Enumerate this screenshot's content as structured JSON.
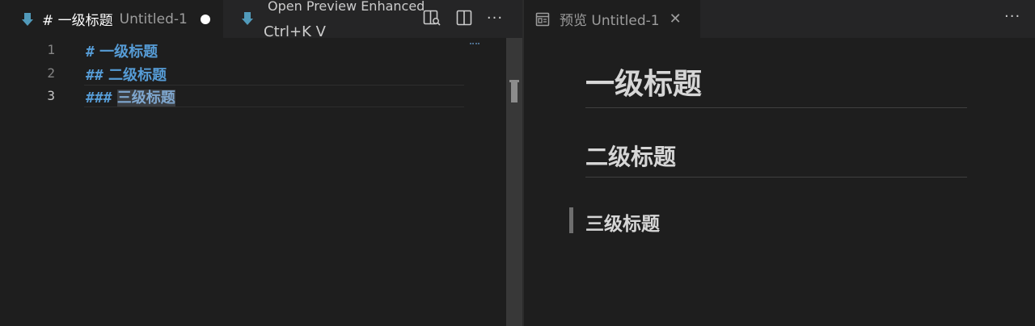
{
  "colors": {
    "editor_bg": "#1e1e1e",
    "tabbar_bg": "#252526",
    "markdown_icon": "#519aba",
    "heading_syntax": "#569cd6",
    "preview_text": "#d6d6d6"
  },
  "left_group": {
    "active_tab": {
      "icon": "markdown-arrow-icon",
      "title": "# 一级标题",
      "description": "Untitled-1",
      "dirty": true
    },
    "tooltip": {
      "icon": "markdown-arrow-icon",
      "title": "Open Preview Enhanced",
      "keybinding": "Ctrl+K V"
    },
    "actions": [
      "open-preview-icon",
      "split-editor-icon",
      "more-actions-icon"
    ],
    "more_label": "···"
  },
  "editor": {
    "lines": [
      {
        "number": "1",
        "hash": "#",
        "text": "一级标题"
      },
      {
        "number": "2",
        "hash": "##",
        "text": "二级标题"
      },
      {
        "number": "3",
        "hash": "###",
        "text": "三级标题"
      }
    ],
    "active_line": 3
  },
  "right_group": {
    "tab": {
      "icon": "preview-icon",
      "title": "预览 Untitled-1",
      "close": "✕"
    },
    "more_label": "···"
  },
  "preview": {
    "h1": "一级标题",
    "h2": "二级标题",
    "h3": "三级标题"
  }
}
